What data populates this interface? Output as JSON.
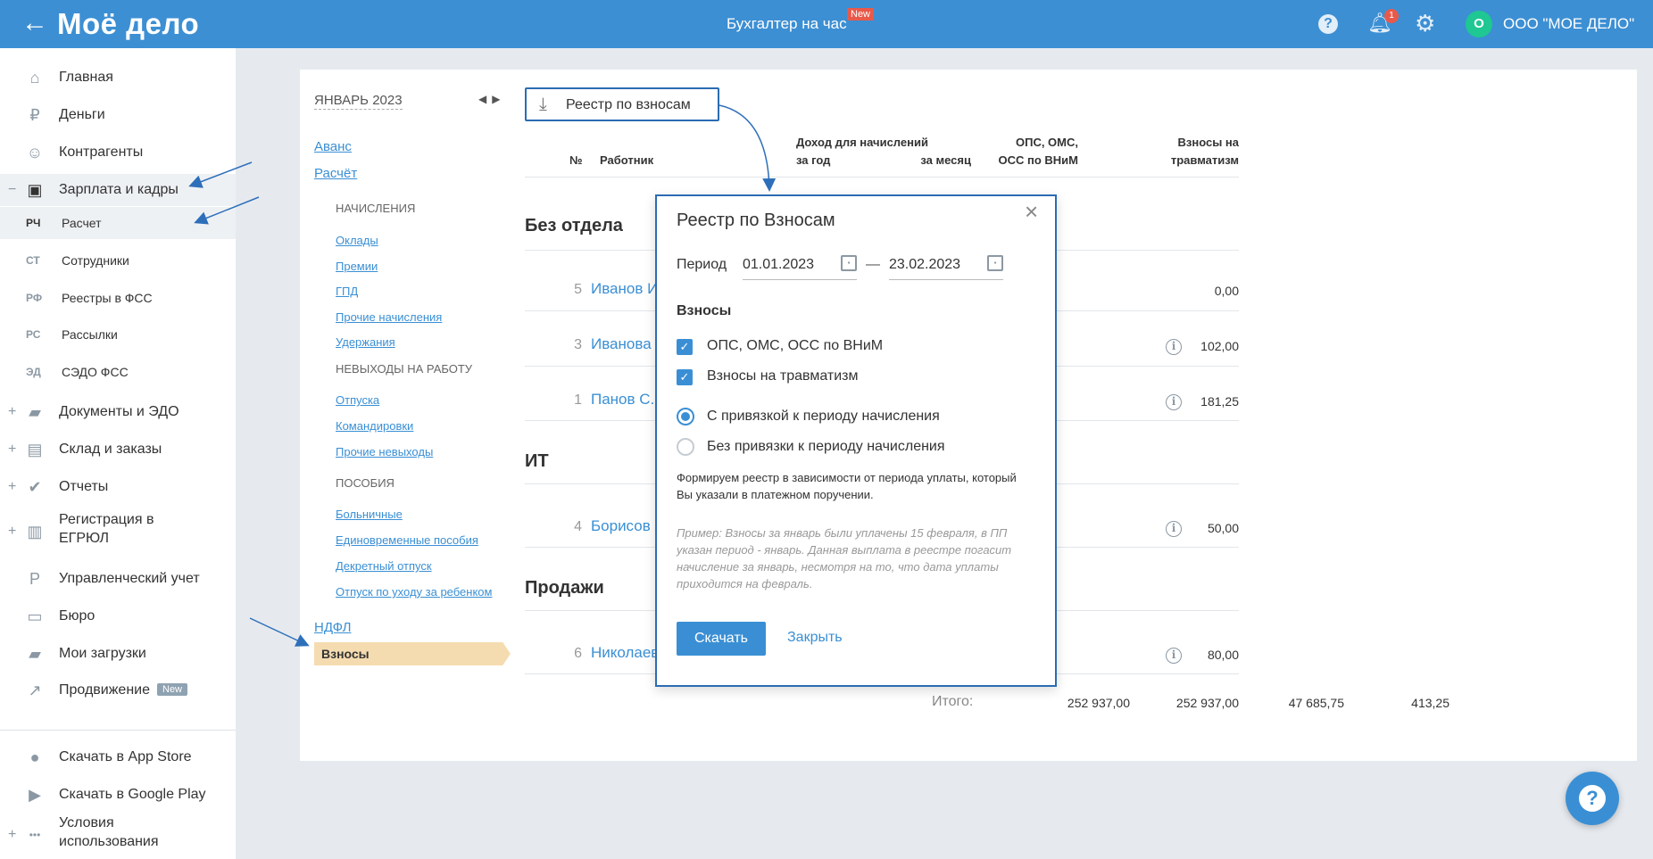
{
  "header": {
    "back_icon": "arrow-left-icon",
    "logo": "Моё дело",
    "center_title": "Бухгалтер на час",
    "center_badge": "New",
    "help_icon": "?",
    "notifications_count": "1",
    "avatar_letter": "О",
    "org_name": "ООО \"МОЕ ДЕЛО\""
  },
  "sidebar": {
    "items": [
      {
        "label": "Главная",
        "icon": "home-icon",
        "glyph": "⌂"
      },
      {
        "label": "Деньги",
        "icon": "money-icon",
        "glyph": "₽"
      },
      {
        "label": "Контрагенты",
        "icon": "person-icon",
        "glyph": "☺"
      },
      {
        "label": "Зарплата и кадры",
        "icon": "wallet-icon",
        "glyph": "▣",
        "expand": "−"
      }
    ],
    "subitems": [
      {
        "abbr": "РЧ",
        "label": "Расчет"
      },
      {
        "abbr": "СТ",
        "label": "Сотрудники"
      },
      {
        "abbr": "РФ",
        "label": "Реестры в ФСС"
      },
      {
        "abbr": "РС",
        "label": "Рассылки"
      },
      {
        "abbr": "ЭД",
        "label": "СЭДО ФСС"
      }
    ],
    "items2": [
      {
        "label": "Документы и ЭДО",
        "icon": "folder-icon",
        "glyph": "▰",
        "expand": "+"
      },
      {
        "label": "Склад и заказы",
        "icon": "warehouse-icon",
        "glyph": "▤",
        "expand": "+"
      },
      {
        "label": "Отчеты",
        "icon": "report-icon",
        "glyph": "✔",
        "expand": "+"
      },
      {
        "label": "Регистрация в",
        "label2": "ЕГРЮЛ",
        "icon": "registration-icon",
        "glyph": "▥",
        "expand": "+"
      },
      {
        "label": "Управленческий учет",
        "icon": "accounting-icon",
        "glyph": "P"
      },
      {
        "label": "Бюро",
        "icon": "briefcase-icon",
        "glyph": "▭"
      },
      {
        "label": "Мои загрузки",
        "icon": "downloads-folder-icon",
        "glyph": "▰"
      },
      {
        "label": "Продвижение",
        "icon": "chart-icon",
        "glyph": "↗",
        "badge": "New"
      }
    ],
    "items3": [
      {
        "label": "Скачать в App Store",
        "icon": "apple-icon",
        "glyph": "●"
      },
      {
        "label": "Скачать в Google Play",
        "icon": "google-play-icon",
        "glyph": "▶"
      },
      {
        "label": "Условия",
        "label2": "использования",
        "icon": "more-icon",
        "glyph": "•••",
        "expand": "+"
      }
    ]
  },
  "salary_menu": {
    "month": "ЯНВАРЬ 2023",
    "arrows": "◀▶",
    "avans": "Аванс",
    "raschet": "Расчёт",
    "sec_accruals": "НАЧИСЛЕНИЯ",
    "accruals": [
      "Оклады",
      "Премии",
      "ГПД",
      "Прочие начисления",
      "Удержания"
    ],
    "sec_absence": "НЕВЫХОДЫ НА РАБОТУ",
    "absence": [
      "Отпуска",
      "Командировки",
      "Прочие невыходы"
    ],
    "sec_benefits": "ПОСОБИЯ",
    "benefits": [
      "Больничные",
      "Единовременные пособия",
      "Декретный отпуск",
      "Отпуск по уходу за ребенком"
    ],
    "ndfl": "НДФЛ",
    "active": "Взносы"
  },
  "register_button": {
    "label": "Реестр по взносам",
    "icon": "download-icon",
    "glyph": "⤓"
  },
  "table": {
    "headers": {
      "num": "№",
      "worker": "Работник",
      "income_year_1": "Доход для начислений",
      "income_year_2": "за год",
      "income_month": "за месяц",
      "ops_1": "ОПС, ОМС,",
      "ops_2": "ОСС по ВНиМ",
      "trauma_1": "Взносы на",
      "trauma_2": "травматизм"
    },
    "groups": [
      {
        "name": "Без отдела"
      },
      {
        "name": "ИТ"
      },
      {
        "name": "Продажи"
      }
    ],
    "rows": [
      {
        "num": "5",
        "name": "Иванов И.",
        "trauma": "0,00"
      },
      {
        "num": "3",
        "name": "Иванова",
        "trauma": "102,00"
      },
      {
        "num": "1",
        "name": "Панов С.",
        "trauma": "181,25"
      },
      {
        "num": "4",
        "name": "Борисов",
        "trauma": "50,00"
      },
      {
        "num": "6",
        "name": "Николаев",
        "trauma": "80,00"
      }
    ],
    "info_glyph": "i",
    "totals": {
      "label": "Итого:",
      "year": "252 937,00",
      "month": "252 937,00",
      "ops": "47 685,75",
      "trauma": "413,25"
    }
  },
  "modal": {
    "title": "Реестр по Взносам",
    "close_glyph": "×",
    "period_label": "Период",
    "date_from": "01.01.2023",
    "date_to": "23.02.2023",
    "dash": "—",
    "section": "Взносы",
    "check1": "ОПС, ОМС, ОСС по ВНиМ",
    "check2": "Взносы на травматизм",
    "check_glyph": "✓",
    "radio1": "С привязкой к периоду начисления",
    "radio2": "Без привязки к периоду начисления",
    "note": "Формируем реестр в зависимости от периода уплаты, который Вы указали в платежном поручении.",
    "example": "Пример: Взносы за январь были уплачены 15 февраля, в ПП указан период - январь. Данная выплата в реестре погасит начисление за январь, несмотря на то, что дата уплаты приходится на февраль.",
    "download": "Скачать",
    "close": "Закрыть"
  },
  "fab_glyph": "?",
  "colors": {
    "brand": "#3c8fd3",
    "accent_border": "#2b6cb3",
    "active_menu": "#f5dcb0",
    "new_badge": "#e9594a",
    "avatar": "#1fc792"
  }
}
